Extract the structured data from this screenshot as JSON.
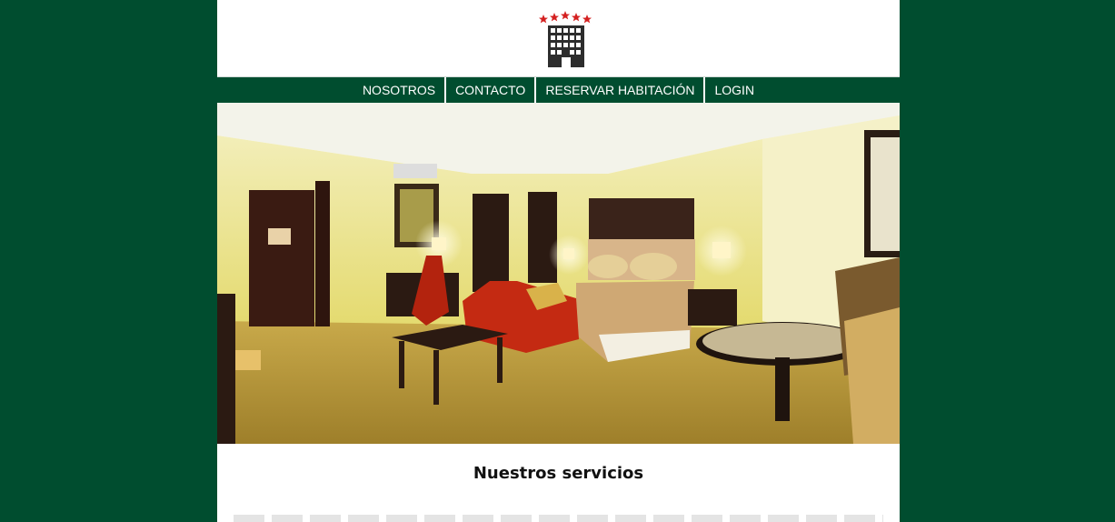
{
  "nav": {
    "items": [
      {
        "label": "NOSOTROS"
      },
      {
        "label": "CONTACTO"
      },
      {
        "label": "RESERVAR HABITACIÓN"
      },
      {
        "label": "LOGIN"
      }
    ]
  },
  "hero": {
    "subject": "hotel-room-photo"
  },
  "main": {
    "title": "Nuestros servicios"
  },
  "colors": {
    "brand_green": "#004d2f",
    "star_red": "#d42020",
    "building": "#2d2d2d"
  }
}
